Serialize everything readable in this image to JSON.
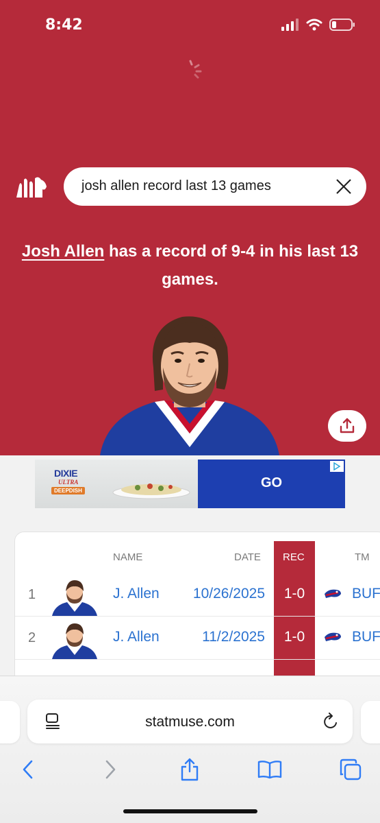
{
  "status_bar": {
    "time": "8:42"
  },
  "search": {
    "query": "josh allen record last 13 games"
  },
  "answer": {
    "player_name": "Josh Allen",
    "text": " has a record of 9-4 in his last 13 games."
  },
  "ad": {
    "brand_line1": "DIXIE",
    "brand_line2": "ULTRA",
    "brand_line3": "DEEPDISH",
    "cta": "GO"
  },
  "table": {
    "headers": {
      "name": "NAME",
      "date": "DATE",
      "rec": "REC",
      "team": "TM"
    },
    "rows": [
      {
        "rank": "1",
        "name": "J. Allen",
        "date": "10/26/2025",
        "rec": "1-0",
        "team": "BUF"
      },
      {
        "rank": "2",
        "name": "J. Allen",
        "date": "11/2/2025",
        "rec": "1-0",
        "team": "BUF"
      }
    ]
  },
  "browser": {
    "url": "statmuse.com"
  },
  "colors": {
    "brand_red": "#b52a3a",
    "link_blue": "#2b72d0",
    "ad_blue": "#1d3fb1"
  },
  "icons": [
    "signal-icon",
    "wifi-icon",
    "battery-icon",
    "loading-spinner-icon",
    "statmuse-logo",
    "clear-icon",
    "share-icon",
    "reader-icon",
    "reload-icon",
    "back-icon",
    "forward-icon",
    "share-icon",
    "bookmarks-icon",
    "tabs-icon"
  ]
}
